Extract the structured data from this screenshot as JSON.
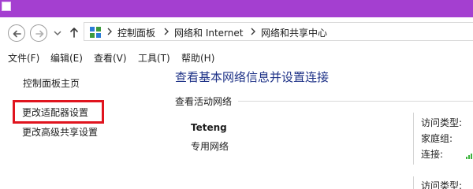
{
  "address_bar": {
    "crumbs": [
      "控制面板",
      "网络和 Internet",
      "网络和共享中心"
    ]
  },
  "menu": {
    "items": [
      "文件(F)",
      "编辑(E)",
      "查看(V)",
      "工具(T)",
      "帮助(H)"
    ]
  },
  "sidebar": {
    "home": "控制面板主页",
    "change_adapter": "更改适配器设置",
    "advanced_sharing": "更改高级共享设置"
  },
  "main": {
    "title": "查看基本网络信息并设置连接",
    "active_networks_label": "查看活动网络",
    "network": {
      "name": "Teteng",
      "type": "专用网络"
    },
    "properties": {
      "access_type_label": "访问类型:",
      "homegroup_label": "家庭组:",
      "connection_label": "连接:",
      "access_type_label_2": "访问类型:"
    }
  },
  "colors": {
    "titlebar": "#a43fd0",
    "title_text": "#1e3287",
    "highlight_box": "#e0141e",
    "signal": "#3cb43c"
  },
  "icons": [
    "back-icon",
    "forward-icon",
    "dropdown-icon",
    "up-icon",
    "control-panel-folder-icon",
    "breadcrumb-arrow-icon",
    "signal-bars-icon"
  ]
}
